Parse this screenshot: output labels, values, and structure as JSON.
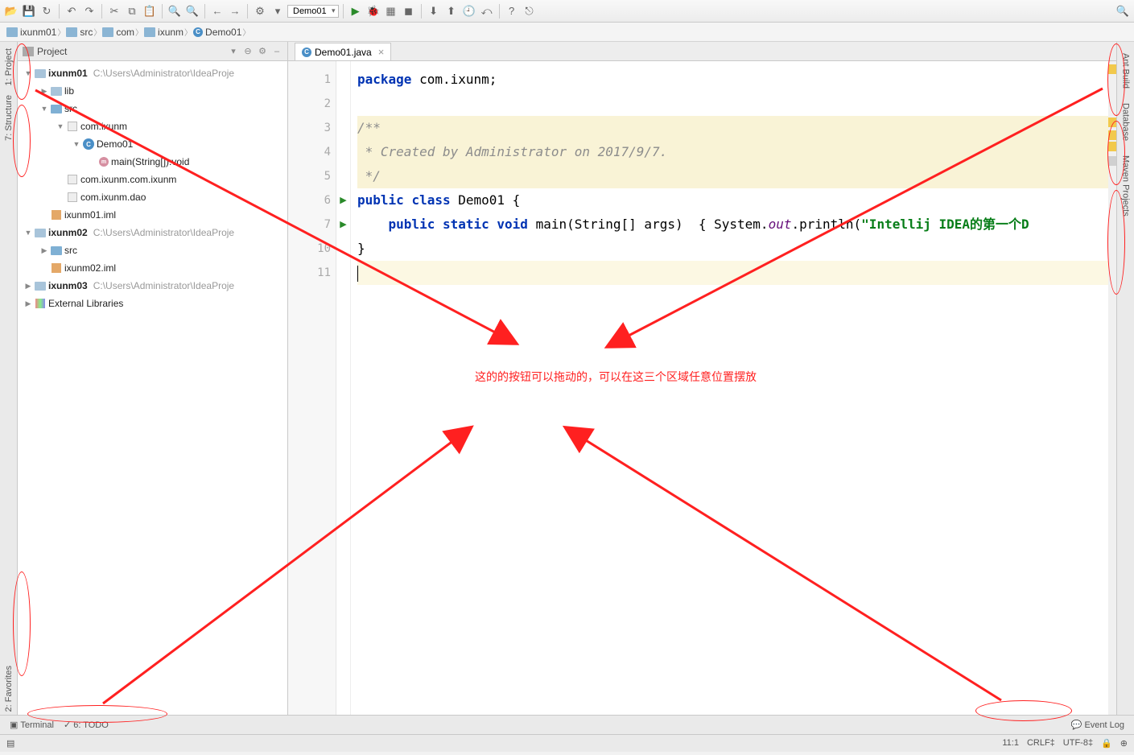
{
  "toolbar": {
    "config": "Demo01"
  },
  "breadcrumb": {
    "items": [
      "ixunm01",
      "src",
      "com",
      "ixunm",
      "Demo01"
    ]
  },
  "sidebar_left": {
    "project": "1: Project",
    "structure": "7: Structure",
    "favorites": "2: Favorites"
  },
  "sidebar_right": {
    "ant": "Ant Build",
    "db": "Database",
    "maven": "Maven Projects"
  },
  "project_panel": {
    "title": "Project",
    "tree": {
      "root1": "ixunm01",
      "root1_path": "C:\\Users\\Administrator\\IdeaProje",
      "lib": "lib",
      "src": "src",
      "pkg1": "com.ixunm",
      "cls": "Demo01",
      "method": "main(String[]):void",
      "pkg2": "com.ixunm.com.ixunm",
      "pkg3": "com.ixunm.dao",
      "iml1": "ixunm01.iml",
      "root2": "ixunm02",
      "root2_path": "C:\\Users\\Administrator\\IdeaProje",
      "src2": "src",
      "iml2": "ixunm02.iml",
      "root3": "ixunm03",
      "root3_path": "C:\\Users\\Administrator\\IdeaProje",
      "ext": "External Libraries"
    }
  },
  "tabs": {
    "file": "Demo01.java"
  },
  "code": {
    "l1_kw": "package",
    "l1_rest": " com.ixunm;",
    "l3": "/**",
    "l4": " * Created by Administrator on 2017/9/7.",
    "l5": " */",
    "l6_kw1": "public",
    "l6_kw2": "class",
    "l6_rest": " Demo01 {",
    "l7_kw1": "public",
    "l7_kw2": "static",
    "l7_kw3": "void",
    "l7_m": " main(String[] args)  { System.",
    "l7_out": "out",
    "l7_p": ".println(",
    "l7_str": "\"Intellij IDEA的第一个D",
    "l10": "}",
    "lines": [
      "1",
      "2",
      "3",
      "4",
      "5",
      "6",
      "7",
      "10",
      "11"
    ]
  },
  "annotation": "这的的按钮可以拖动的，可以在这三个区域任意位置摆放",
  "bottom": {
    "terminal": "Terminal",
    "todo": "6: TODO",
    "eventlog": "Event Log"
  },
  "status": {
    "pos": "11:1",
    "sep": "CRLF‡",
    "enc": "UTF-8‡"
  }
}
